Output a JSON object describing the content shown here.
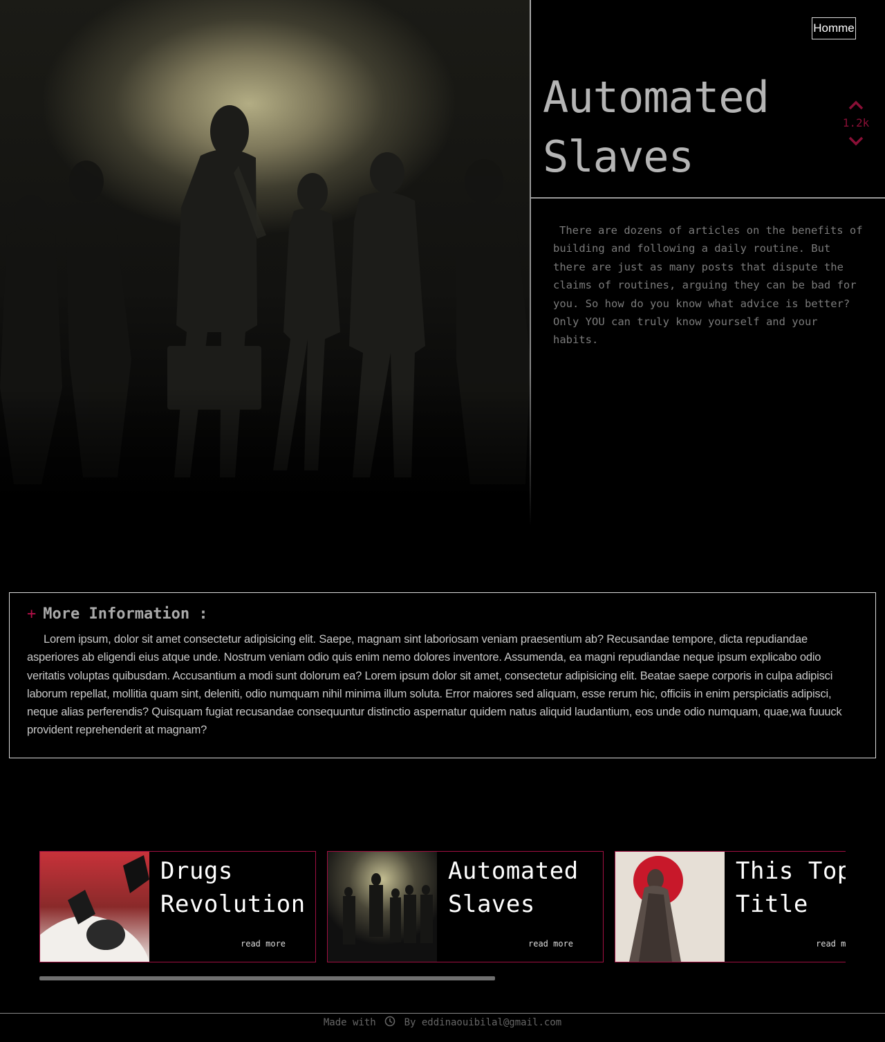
{
  "nav": {
    "home_label": "Homme"
  },
  "hero": {
    "image_icon": "walking-crowd-illustration",
    "title": "Automated Slaves",
    "votes": "1.2k",
    "text": "There are dozens of articles on the benefits of building and following a daily routine. But there are just as many posts that dispute the claims of routines, arguing they can be bad for you. So how do you know what advice is better? Only YOU can truly know yourself and your habits."
  },
  "info": {
    "plus": "+",
    "title": "More Information :",
    "body": "Lorem ipsum, dolor sit amet consectetur adipisicing elit. Saepe, magnam sint laboriosam veniam praesentium ab? Recusandae tempore, dicta repudiandae asperiores ab eligendi eius atque unde. Nostrum veniam odio quis enim nemo dolores inventore. Assumenda, ea magni repudiandae neque ipsum explicabo odio veritatis voluptas quibusdam. Accusantium a modi sunt dolorum ea? Lorem ipsum dolor sit amet, consectetur adipisicing elit. Beatae saepe corporis in culpa adipisci laborum repellat, mollitia quam sint, deleniti, odio numquam nihil minima illum soluta. Error maiores sed aliquam, esse rerum hic, officiis in enim perspiciatis adipisci, neque alias perferendis? Quisquam fugiat recusandae consequuntur distinctio aspernatur quidem natus aliquid laudantium, eos unde odio numquam, quae,wa fuuuck provident reprehenderit at magnam?"
  },
  "cards": [
    {
      "title": "Drugs Revolution",
      "read_more": "read more"
    },
    {
      "title": "Automated Slaves",
      "read_more": "read more"
    },
    {
      "title": "This Topic Title",
      "read_more": "read more"
    }
  ],
  "footer": {
    "made_with": "Made with",
    "icon": "clock-icon",
    "by": "By eddinaouibilal@gmail.com"
  },
  "colors": {
    "accent": "#a31043",
    "background": "#000000",
    "muted_text": "#7b7b7b"
  }
}
